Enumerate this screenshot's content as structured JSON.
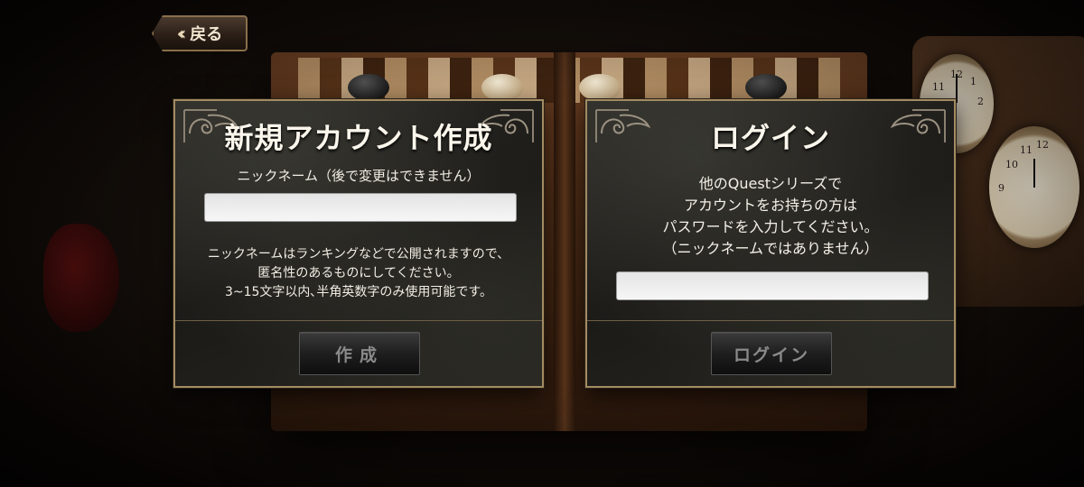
{
  "back_button": {
    "label": "戻る"
  },
  "signup": {
    "title": "新規アカウント作成",
    "field_label": "ニックネーム（後で変更はできません）",
    "input_value": "",
    "note_lines": [
      "ニックネームはランキングなどで公開されますので、",
      "匿名性のあるものにしてください。",
      "3~15文字以内､半角英数字のみ使用可能です。"
    ],
    "submit_label": "作成"
  },
  "login": {
    "title": "ログイン",
    "info_lines": [
      "他のQuestシリーズで",
      "アカウントをお持ちの方は",
      "パスワードを入力してください。",
      "（ニックネームではありません）"
    ],
    "input_value": "",
    "submit_label": "ログイン"
  },
  "clock_numbers": [
    "12",
    "1",
    "2",
    "10",
    "11",
    "9"
  ],
  "colors": {
    "panel_border": "#a38b62",
    "title_text": "#fbf6ec",
    "button_text_disabled": "#8a8a8a"
  }
}
